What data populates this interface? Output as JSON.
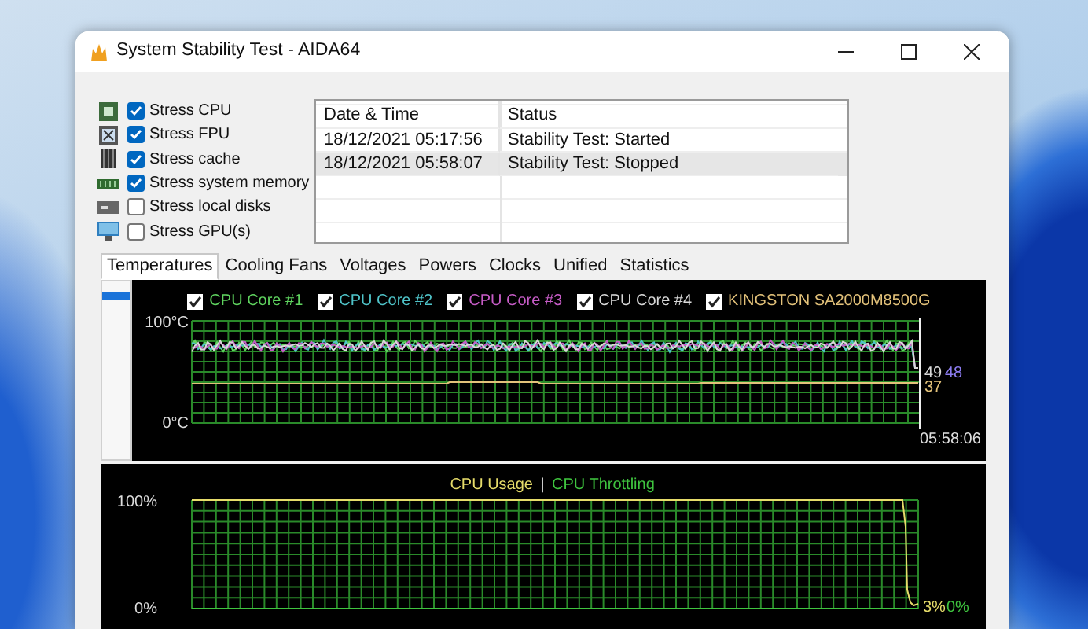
{
  "window": {
    "title": "System Stability Test - AIDA64"
  },
  "stress_options": [
    {
      "label": "Stress CPU",
      "checked": true,
      "kind": "cpu"
    },
    {
      "label": "Stress FPU",
      "checked": true,
      "kind": "fpu"
    },
    {
      "label": "Stress cache",
      "checked": true,
      "kind": "cache"
    },
    {
      "label": "Stress system memory",
      "checked": true,
      "kind": "memory"
    },
    {
      "label": "Stress local disks",
      "checked": false,
      "kind": "disk"
    },
    {
      "label": "Stress GPU(s)",
      "checked": false,
      "kind": "gpu"
    }
  ],
  "log": {
    "columns": [
      "Date & Time",
      "Status"
    ],
    "rows": [
      {
        "date_time": "18/12/2021 05:17:56",
        "status": "Stability Test: Started",
        "selected": false
      },
      {
        "date_time": "18/12/2021 05:58:07",
        "status": "Stability Test: Stopped",
        "selected": true
      }
    ]
  },
  "tabs": [
    {
      "label": "Temperatures",
      "selected": true
    },
    {
      "label": "Cooling Fans",
      "selected": false
    },
    {
      "label": "Voltages",
      "selected": false
    },
    {
      "label": "Powers",
      "selected": false
    },
    {
      "label": "Clocks",
      "selected": false
    },
    {
      "label": "Unified",
      "selected": false
    },
    {
      "label": "Statistics",
      "selected": false
    }
  ],
  "temperature_chart": {
    "series": [
      {
        "name": "CPU Core #1",
        "checked": true,
        "color": "#5fd35f"
      },
      {
        "name": "CPU Core #2",
        "checked": true,
        "color": "#4fc3c8"
      },
      {
        "name": "CPU Core #3",
        "checked": true,
        "color": "#c65cc6"
      },
      {
        "name": "CPU Core #4",
        "checked": true,
        "color": "#d8d8d8"
      },
      {
        "name": "KINGSTON SA2000M8500G",
        "checked": true,
        "color": "#e3c27a"
      }
    ],
    "y_top_label": "100°C",
    "y_bottom_label": "0°C",
    "readings": [
      {
        "text": "49",
        "color": "#d8d8d8"
      },
      {
        "text": "48",
        "color": "#8c7cf0"
      },
      {
        "text": "37",
        "color": "#e3c27a"
      }
    ],
    "time": "05:58:06"
  },
  "usage_chart": {
    "series": [
      {
        "name": "CPU Usage",
        "color": "#e6dc6a"
      },
      {
        "name": "CPU Throttling",
        "color": "#3fc43f"
      }
    ],
    "separator": "|",
    "y_top_label": "100%",
    "y_bottom_label": "0%",
    "readings": [
      {
        "text": "3%",
        "color": "#e6dc6a"
      },
      {
        "text": "0%",
        "color": "#3fc43f"
      }
    ]
  }
}
